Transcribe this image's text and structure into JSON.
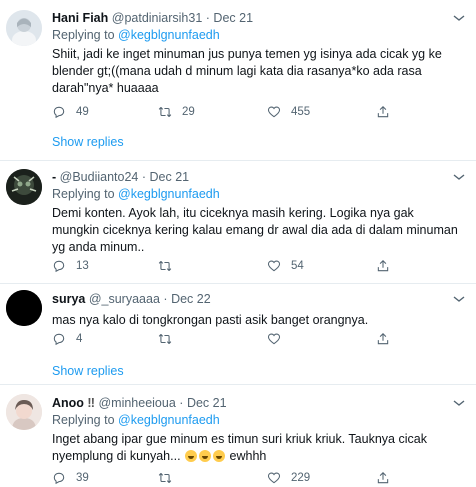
{
  "tweets": [
    {
      "name": "Hani Fiah",
      "handle": "@patdiniarsih31",
      "date": "Dec 21",
      "reply_prefix": "Replying to",
      "reply_to": "@kegblgnunfaedh",
      "text": "Shiit, jadi ke inget minuman jus punya temen yg isinya ada cicak yg ke blender gt;((mana udah d minum lagi kata dia rasanya*ko ada rasa darah\"nya* huaaaa",
      "replies": "49",
      "retweets": "29",
      "likes": "455",
      "show_replies": "Show replies"
    },
    {
      "name": "-",
      "handle": "@Budiianto24",
      "date": "Dec 21",
      "reply_prefix": "Replying to",
      "reply_to": "@kegblgnunfaedh",
      "text": "Demi konten. Ayok lah, itu ciceknya masih kering. Logika nya gak mungkin ciceknya kering kalau emang dr awal dia ada di dalam minuman yg anda minum..",
      "replies": "13",
      "retweets": "",
      "likes": "54"
    },
    {
      "name": "surya",
      "handle": "@_suryaaaa",
      "date": "Dec 22",
      "text": "mas nya kalo di tongkrongan pasti asik banget orangnya.",
      "replies": "4",
      "retweets": "",
      "likes": "",
      "show_replies": "Show replies"
    },
    {
      "name": "Anoo",
      "name_suffix": "‼",
      "handle": "@minheeioua",
      "date": "Dec 21",
      "reply_prefix": "Replying to",
      "reply_to": "@kegblgnunfaedh",
      "text": "Inget abang ipar gue minum es timun suri kriuk kriuk. Tauknya cicak nyemplung di kunyah...",
      "text_tail": "ewhhh",
      "replies": "39",
      "retweets": "",
      "likes": "229"
    }
  ],
  "colors": {
    "accent": "#1d9bf0",
    "muted": "#536471",
    "divider": "#e6ecf0"
  }
}
